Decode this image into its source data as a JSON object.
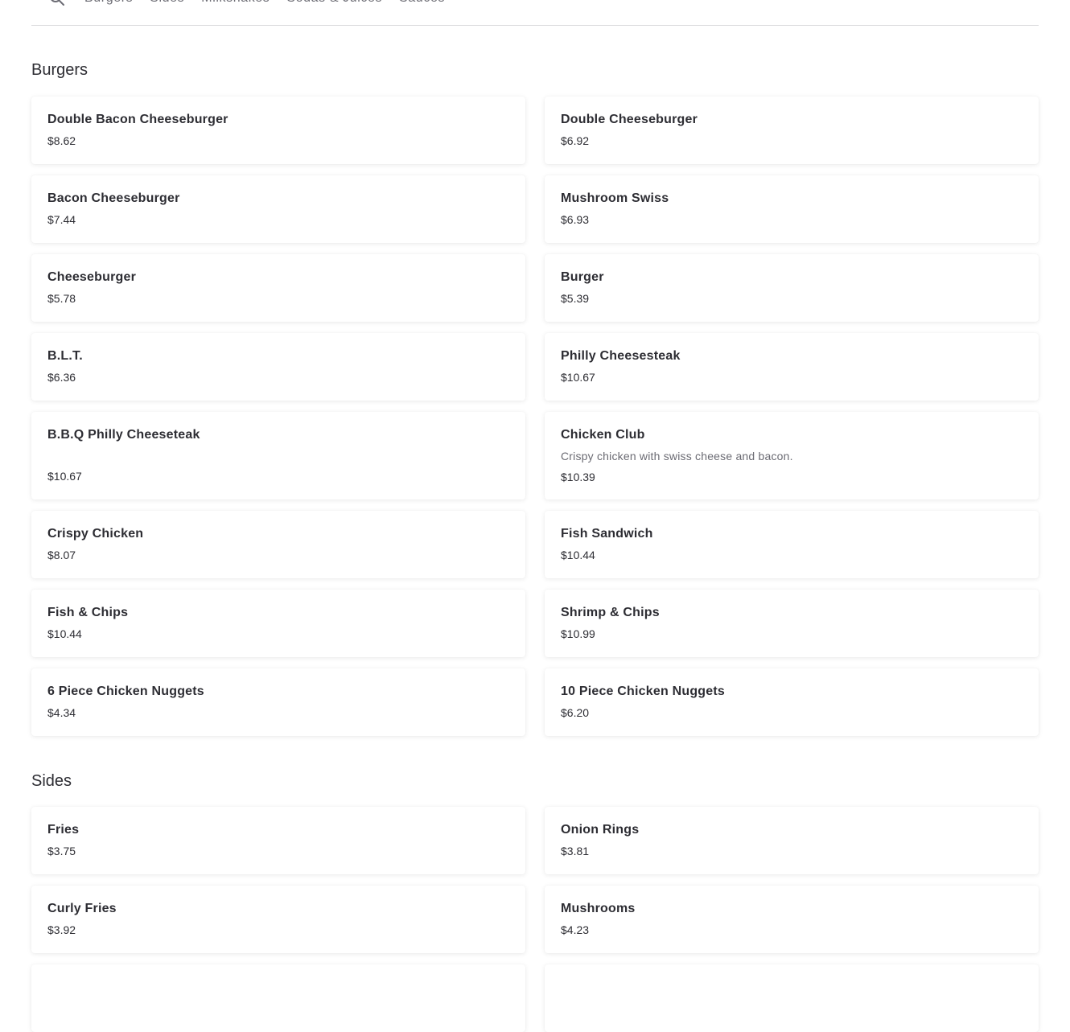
{
  "nav": {
    "search_icon": "search-icon",
    "tabs": [
      "Burgers",
      "Sides",
      "Milkshakes",
      "Sodas & Juices",
      "Sauces"
    ]
  },
  "sections": [
    {
      "title": "Burgers",
      "items": [
        {
          "name": "Double Bacon Cheeseburger",
          "price": "$8.62"
        },
        {
          "name": "Double Cheeseburger",
          "price": "$6.92"
        },
        {
          "name": "Bacon Cheeseburger",
          "price": "$7.44"
        },
        {
          "name": "Mushroom Swiss",
          "price": "$6.93"
        },
        {
          "name": "Cheeseburger",
          "price": "$5.78"
        },
        {
          "name": "Burger",
          "price": "$5.39"
        },
        {
          "name": "B.L.T.",
          "price": "$6.36"
        },
        {
          "name": "Philly Cheesesteak",
          "price": "$10.67"
        },
        {
          "name": "B.B.Q Philly Cheeseteak",
          "price": "$10.67"
        },
        {
          "name": "Chicken Club",
          "description": "Crispy chicken with swiss cheese and bacon.",
          "price": "$10.39"
        },
        {
          "name": "Crispy Chicken",
          "price": "$8.07"
        },
        {
          "name": "Fish Sandwich",
          "price": "$10.44"
        },
        {
          "name": "Fish & Chips",
          "price": "$10.44"
        },
        {
          "name": "Shrimp & Chips",
          "price": "$10.99"
        },
        {
          "name": "6 Piece Chicken Nuggets",
          "price": "$4.34"
        },
        {
          "name": "10 Piece Chicken Nuggets",
          "price": "$6.20"
        }
      ]
    },
    {
      "title": "Sides",
      "items": [
        {
          "name": "Fries",
          "price": "$3.75"
        },
        {
          "name": "Onion Rings",
          "price": "$3.81"
        },
        {
          "name": "Curly Fries",
          "price": "$3.92"
        },
        {
          "name": "Mushrooms",
          "price": "$4.23"
        }
      ]
    }
  ]
}
